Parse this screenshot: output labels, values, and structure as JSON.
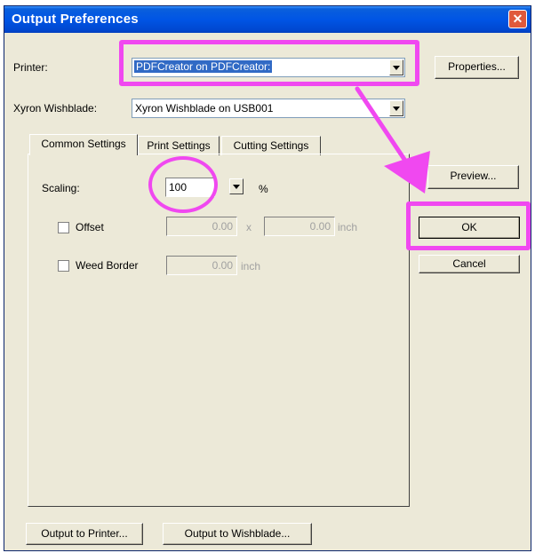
{
  "window": {
    "title": "Output Preferences",
    "close_label": "✕"
  },
  "printer": {
    "label": "Printer:",
    "value": "PDFCreator on PDFCreator:"
  },
  "wishblade": {
    "label": "Xyron Wishblade:",
    "value": "Xyron Wishblade on USB001"
  },
  "buttons": {
    "properties": "Properties...",
    "preview": "Preview...",
    "ok": "OK",
    "cancel": "Cancel",
    "output_printer": "Output to Printer...",
    "output_wishblade": "Output to Wishblade..."
  },
  "tabs": [
    "Common Settings",
    "Print Settings",
    "Cutting Settings"
  ],
  "scaling": {
    "label": "Scaling:",
    "value": "100",
    "unit": "%"
  },
  "offset": {
    "label": "Offset",
    "x_value": "0.00",
    "x_sep": "x",
    "y_value": "0.00",
    "unit": "inch"
  },
  "weed_border": {
    "label": "Weed Border",
    "value": "0.00",
    "unit": "inch"
  },
  "colors": {
    "highlight": "#f048f0",
    "title_bar": "#0055e5",
    "dialog_bg": "#ece9d8"
  }
}
